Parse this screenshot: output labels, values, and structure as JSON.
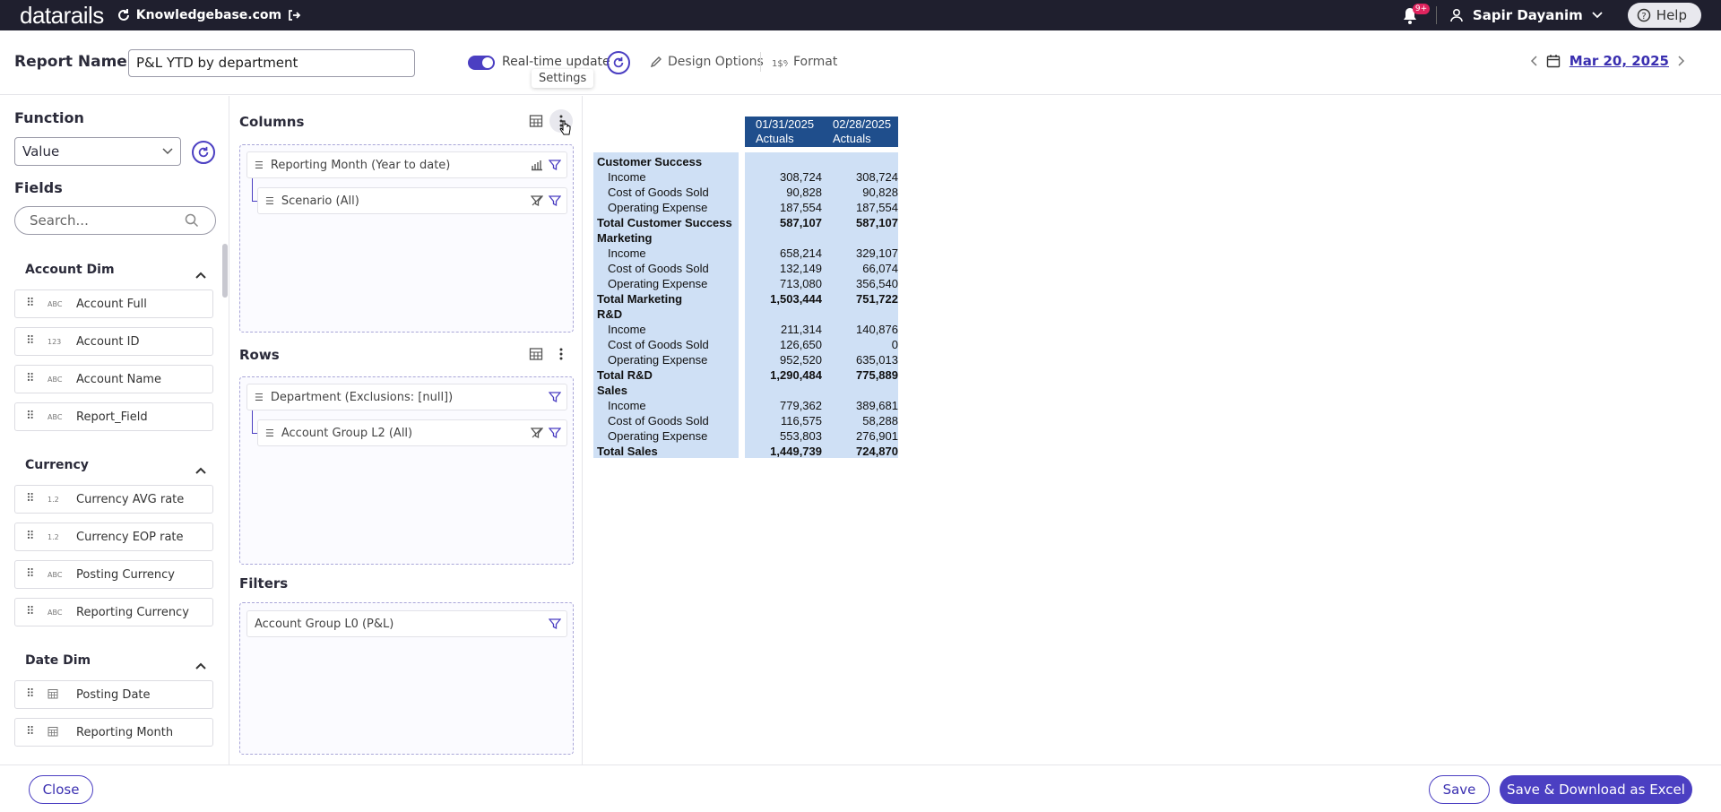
{
  "topbar": {
    "logo": "datarails",
    "workspace": "Knowledgebase.com",
    "notif_badge": "9+",
    "user_name": "Sapir Dayanim",
    "help_label": "Help"
  },
  "header": {
    "report_name_label": "Report Name",
    "report_name_value": "P&L YTD by department",
    "realtime_label": "Real-time update",
    "realtime_on": true,
    "tooltip": "Settings",
    "design_options": "Design Options",
    "format": "Format",
    "date": "Mar 20, 2025"
  },
  "function_panel": {
    "function_title": "Function",
    "function_value": "Value",
    "fields_title": "Fields",
    "search_placeholder": "Search...",
    "groups": [
      {
        "title": "Account Dim",
        "fields": [
          {
            "type": "ABC",
            "label": "Account Full"
          },
          {
            "type": "123",
            "label": "Account ID"
          },
          {
            "type": "ABC",
            "label": "Account Name"
          },
          {
            "type": "ABC",
            "label": "Report_Field"
          }
        ]
      },
      {
        "title": "Currency",
        "fields": [
          {
            "type": "1.2",
            "label": "Currency AVG rate"
          },
          {
            "type": "1.2",
            "label": "Currency EOP rate"
          },
          {
            "type": "ABC",
            "label": "Posting Currency"
          },
          {
            "type": "ABC",
            "label": "Reporting Currency"
          }
        ]
      },
      {
        "title": "Date Dim",
        "fields": [
          {
            "type": "cal",
            "label": "Posting Date"
          },
          {
            "type": "cal",
            "label": "Reporting Month"
          }
        ]
      }
    ]
  },
  "config": {
    "columns_title": "Columns",
    "columns": [
      "Reporting Month (Year to date)",
      "Scenario (All)"
    ],
    "rows_title": "Rows",
    "rows": [
      "Department (Exclusions: [null])",
      "Account Group L2 (All)"
    ],
    "filters_title": "Filters",
    "filters": [
      "Account Group L0 (P&L)"
    ]
  },
  "report": {
    "col_headers": [
      {
        "date": "01/31/2025",
        "scenario": "Actuals"
      },
      {
        "date": "02/28/2025",
        "scenario": "Actuals"
      }
    ],
    "rows": [
      {
        "label": "Customer Success",
        "kind": "group",
        "v1": "",
        "v2": ""
      },
      {
        "label": "Income",
        "kind": "item",
        "v1": "308,724",
        "v2": "308,724"
      },
      {
        "label": "Cost of Goods Sold",
        "kind": "item",
        "v1": "90,828",
        "v2": "90,828"
      },
      {
        "label": "Operating Expense",
        "kind": "item",
        "v1": "187,554",
        "v2": "187,554"
      },
      {
        "label": "Total Customer Success",
        "kind": "total",
        "v1": "587,107",
        "v2": "587,107"
      },
      {
        "label": "Marketing",
        "kind": "group",
        "v1": "",
        "v2": ""
      },
      {
        "label": "Income",
        "kind": "item",
        "v1": "658,214",
        "v2": "329,107"
      },
      {
        "label": "Cost of Goods Sold",
        "kind": "item",
        "v1": "132,149",
        "v2": "66,074"
      },
      {
        "label": "Operating Expense",
        "kind": "item",
        "v1": "713,080",
        "v2": "356,540"
      },
      {
        "label": "Total Marketing",
        "kind": "total",
        "v1": "1,503,444",
        "v2": "751,722"
      },
      {
        "label": "R&D",
        "kind": "group",
        "v1": "",
        "v2": ""
      },
      {
        "label": "Income",
        "kind": "item",
        "v1": "211,314",
        "v2": "140,876"
      },
      {
        "label": "Cost of Goods Sold",
        "kind": "item",
        "v1": "126,650",
        "v2": "0"
      },
      {
        "label": "Operating Expense",
        "kind": "item",
        "v1": "952,520",
        "v2": "635,013"
      },
      {
        "label": "Total R&D",
        "kind": "total",
        "v1": "1,290,484",
        "v2": "775,889"
      },
      {
        "label": "Sales",
        "kind": "group",
        "v1": "",
        "v2": ""
      },
      {
        "label": "Income",
        "kind": "item",
        "v1": "779,362",
        "v2": "389,681"
      },
      {
        "label": "Cost of Goods Sold",
        "kind": "item",
        "v1": "116,575",
        "v2": "58,288"
      },
      {
        "label": "Operating Expense",
        "kind": "item",
        "v1": "553,803",
        "v2": "276,901"
      },
      {
        "label": "Total Sales",
        "kind": "total",
        "v1": "1,449,739",
        "v2": "724,870"
      }
    ]
  },
  "footer": {
    "close": "Close",
    "save": "Save",
    "save_download": "Save & Download as Excel"
  },
  "colors": {
    "accent": "#4b3fc2",
    "topbar": "#1f1f2e",
    "report_header": "#1f4e8c",
    "report_cell": "#cfe0f5"
  }
}
